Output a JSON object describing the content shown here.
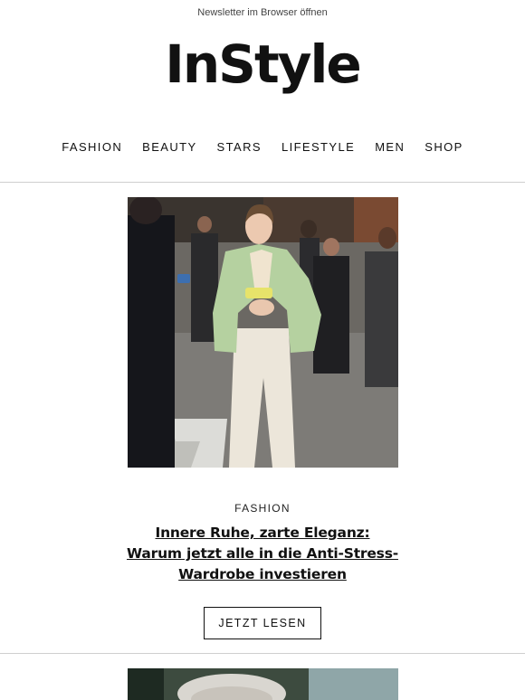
{
  "header": {
    "browser_link": "Newsletter im Browser öffnen",
    "logo_text": "InStyle"
  },
  "nav": {
    "items": [
      {
        "label": "FASHION"
      },
      {
        "label": "BEAUTY"
      },
      {
        "label": "STARS"
      },
      {
        "label": "LIFESTYLE"
      },
      {
        "label": "MEN"
      },
      {
        "label": "SHOP"
      }
    ]
  },
  "article": {
    "category": "FASHION",
    "headline": "Innere Ruhe, zarte Eleganz: Warum jetzt alle in die Anti-Stress-Wardrobe investieren",
    "cta_label": "JETZT LESEN"
  },
  "colors": {
    "text": "#111111",
    "divider": "#cfcfcf",
    "blazer": "#b5d1a0"
  }
}
